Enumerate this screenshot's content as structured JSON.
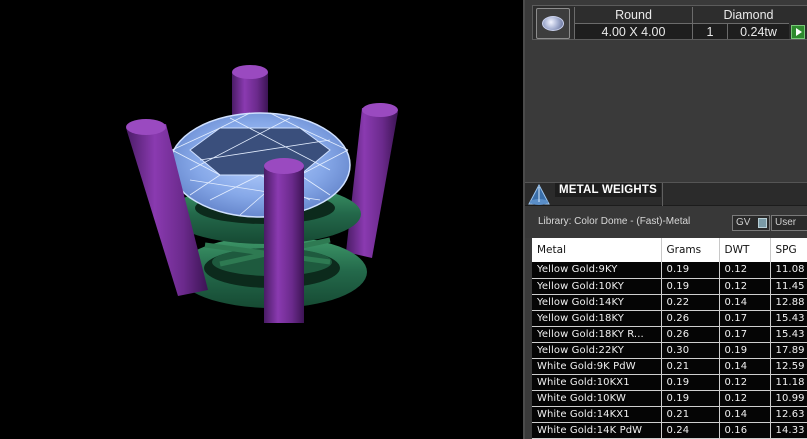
{
  "stone": {
    "thumbnail_icon": "round-diamond-icon",
    "headers": {
      "shape": "Round",
      "type": "Diamond"
    },
    "values": {
      "size": "4.00 X 4.00",
      "qty": "1",
      "weight": "0.24tw"
    },
    "action_icon": "play-arrow-icon"
  },
  "metal_weights": {
    "icon": "color-dome-icon",
    "title": "METAL WEIGHTS",
    "library": "Library: Color Dome - (Fast)-Metal",
    "gv_label": "GV",
    "user_label": "User",
    "columns": [
      "Metal",
      "Grams",
      "DWT",
      "SPG"
    ],
    "rows": [
      [
        "Yellow Gold:9KY",
        "0.19",
        "0.12",
        "11.08"
      ],
      [
        "Yellow Gold:10KY",
        "0.19",
        "0.12",
        "11.45"
      ],
      [
        "Yellow Gold:14KY",
        "0.22",
        "0.14",
        "12.88"
      ],
      [
        "Yellow Gold:18KY",
        "0.26",
        "0.17",
        "15.43"
      ],
      [
        "Yellow Gold:18KY R...",
        "0.26",
        "0.17",
        "15.43"
      ],
      [
        "Yellow Gold:22KY",
        "0.30",
        "0.19",
        "17.89"
      ],
      [
        "White Gold:9K PdW",
        "0.21",
        "0.14",
        "12.59"
      ],
      [
        "White Gold:10KX1",
        "0.19",
        "0.12",
        "11.18"
      ],
      [
        "White Gold:10KW",
        "0.19",
        "0.12",
        "10.99"
      ],
      [
        "White Gold:14KX1",
        "0.21",
        "0.14",
        "12.63"
      ],
      [
        "White Gold:14K PdW",
        "0.24",
        "0.16",
        "14.33"
      ]
    ]
  },
  "colors": {
    "prong": "#7a2c9a",
    "band": "#2e7a52",
    "stone_wire": "#a9c8ff",
    "panel_bg": "#3a3a3a",
    "accent_green": "#2e8a2e"
  }
}
